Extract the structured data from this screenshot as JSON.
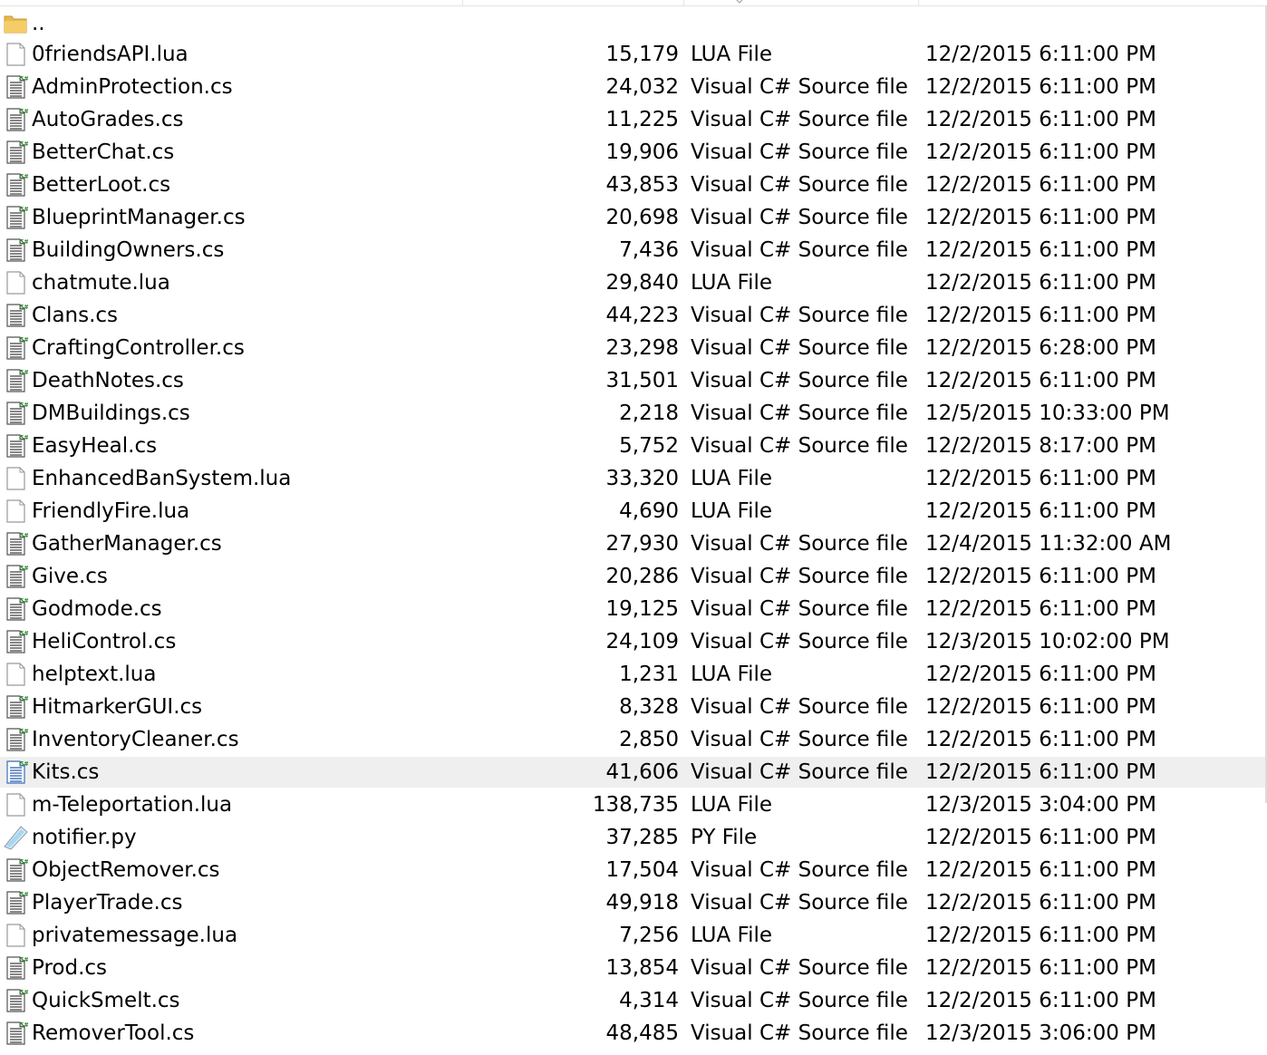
{
  "parent_folder": {
    "name": "..",
    "icon": "folder-icon"
  },
  "selected_row": 22,
  "colors": {
    "row_highlight": "#efefef",
    "folder": "#e8b84a",
    "cs_badge": "#2d8a2d",
    "selected_icon": "#3b6fb6"
  },
  "files": [
    {
      "name": "0friendsAPI.lua",
      "size": "15,179",
      "type": "LUA File",
      "date": "12/2/2015 6:11:00 PM",
      "icon": "blank-file-icon"
    },
    {
      "name": "AdminProtection.cs",
      "size": "24,032",
      "type": "Visual C# Source file",
      "date": "12/2/2015 6:11:00 PM",
      "icon": "csharp-file-icon"
    },
    {
      "name": "AutoGrades.cs",
      "size": "11,225",
      "type": "Visual C# Source file",
      "date": "12/2/2015 6:11:00 PM",
      "icon": "csharp-file-icon"
    },
    {
      "name": "BetterChat.cs",
      "size": "19,906",
      "type": "Visual C# Source file",
      "date": "12/2/2015 6:11:00 PM",
      "icon": "csharp-file-icon"
    },
    {
      "name": "BetterLoot.cs",
      "size": "43,853",
      "type": "Visual C# Source file",
      "date": "12/2/2015 6:11:00 PM",
      "icon": "csharp-file-icon"
    },
    {
      "name": "BlueprintManager.cs",
      "size": "20,698",
      "type": "Visual C# Source file",
      "date": "12/2/2015 6:11:00 PM",
      "icon": "csharp-file-icon"
    },
    {
      "name": "BuildingOwners.cs",
      "size": "7,436",
      "type": "Visual C# Source file",
      "date": "12/2/2015 6:11:00 PM",
      "icon": "csharp-file-icon"
    },
    {
      "name": "chatmute.lua",
      "size": "29,840",
      "type": "LUA File",
      "date": "12/2/2015 6:11:00 PM",
      "icon": "blank-file-icon"
    },
    {
      "name": "Clans.cs",
      "size": "44,223",
      "type": "Visual C# Source file",
      "date": "12/2/2015 6:11:00 PM",
      "icon": "csharp-file-icon"
    },
    {
      "name": "CraftingController.cs",
      "size": "23,298",
      "type": "Visual C# Source file",
      "date": "12/2/2015 6:28:00 PM",
      "icon": "csharp-file-icon"
    },
    {
      "name": "DeathNotes.cs",
      "size": "31,501",
      "type": "Visual C# Source file",
      "date": "12/2/2015 6:11:00 PM",
      "icon": "csharp-file-icon"
    },
    {
      "name": "DMBuildings.cs",
      "size": "2,218",
      "type": "Visual C# Source file",
      "date": "12/5/2015 10:33:00 PM",
      "icon": "csharp-file-icon"
    },
    {
      "name": "EasyHeal.cs",
      "size": "5,752",
      "type": "Visual C# Source file",
      "date": "12/2/2015 8:17:00 PM",
      "icon": "csharp-file-icon"
    },
    {
      "name": "EnhancedBanSystem.lua",
      "size": "33,320",
      "type": "LUA File",
      "date": "12/2/2015 6:11:00 PM",
      "icon": "blank-file-icon"
    },
    {
      "name": "FriendlyFire.lua",
      "size": "4,690",
      "type": "LUA File",
      "date": "12/2/2015 6:11:00 PM",
      "icon": "blank-file-icon"
    },
    {
      "name": "GatherManager.cs",
      "size": "27,930",
      "type": "Visual C# Source file",
      "date": "12/4/2015 11:32:00 AM",
      "icon": "csharp-file-icon"
    },
    {
      "name": "Give.cs",
      "size": "20,286",
      "type": "Visual C# Source file",
      "date": "12/2/2015 6:11:00 PM",
      "icon": "csharp-file-icon"
    },
    {
      "name": "Godmode.cs",
      "size": "19,125",
      "type": "Visual C# Source file",
      "date": "12/2/2015 6:11:00 PM",
      "icon": "csharp-file-icon"
    },
    {
      "name": "HeliControl.cs",
      "size": "24,109",
      "type": "Visual C# Source file",
      "date": "12/3/2015 10:02:00 PM",
      "icon": "csharp-file-icon"
    },
    {
      "name": "helptext.lua",
      "size": "1,231",
      "type": "LUA File",
      "date": "12/2/2015 6:11:00 PM",
      "icon": "blank-file-icon"
    },
    {
      "name": "HitmarkerGUI.cs",
      "size": "8,328",
      "type": "Visual C# Source file",
      "date": "12/2/2015 6:11:00 PM",
      "icon": "csharp-file-icon"
    },
    {
      "name": "InventoryCleaner.cs",
      "size": "2,850",
      "type": "Visual C# Source file",
      "date": "12/2/2015 6:11:00 PM",
      "icon": "csharp-file-icon"
    },
    {
      "name": "Kits.cs",
      "size": "41,606",
      "type": "Visual C# Source file",
      "date": "12/2/2015 6:11:00 PM",
      "icon": "csharp-file-icon-selected"
    },
    {
      "name": "m-Teleportation.lua",
      "size": "138,735",
      "type": "LUA File",
      "date": "12/3/2015 3:04:00 PM",
      "icon": "blank-file-icon"
    },
    {
      "name": "notifier.py",
      "size": "37,285",
      "type": "PY File",
      "date": "12/2/2015 6:11:00 PM",
      "icon": "python-file-icon"
    },
    {
      "name": "ObjectRemover.cs",
      "size": "17,504",
      "type": "Visual C# Source file",
      "date": "12/2/2015 6:11:00 PM",
      "icon": "csharp-file-icon"
    },
    {
      "name": "PlayerTrade.cs",
      "size": "49,918",
      "type": "Visual C# Source file",
      "date": "12/2/2015 6:11:00 PM",
      "icon": "csharp-file-icon"
    },
    {
      "name": "privatemessage.lua",
      "size": "7,256",
      "type": "LUA File",
      "date": "12/2/2015 6:11:00 PM",
      "icon": "blank-file-icon"
    },
    {
      "name": "Prod.cs",
      "size": "13,854",
      "type": "Visual C# Source file",
      "date": "12/2/2015 6:11:00 PM",
      "icon": "csharp-file-icon"
    },
    {
      "name": "QuickSmelt.cs",
      "size": "4,314",
      "type": "Visual C# Source file",
      "date": "12/2/2015 6:11:00 PM",
      "icon": "csharp-file-icon"
    },
    {
      "name": "RemoverTool.cs",
      "size": "48,485",
      "type": "Visual C# Source file",
      "date": "12/3/2015 3:06:00 PM",
      "icon": "csharp-file-icon"
    }
  ]
}
